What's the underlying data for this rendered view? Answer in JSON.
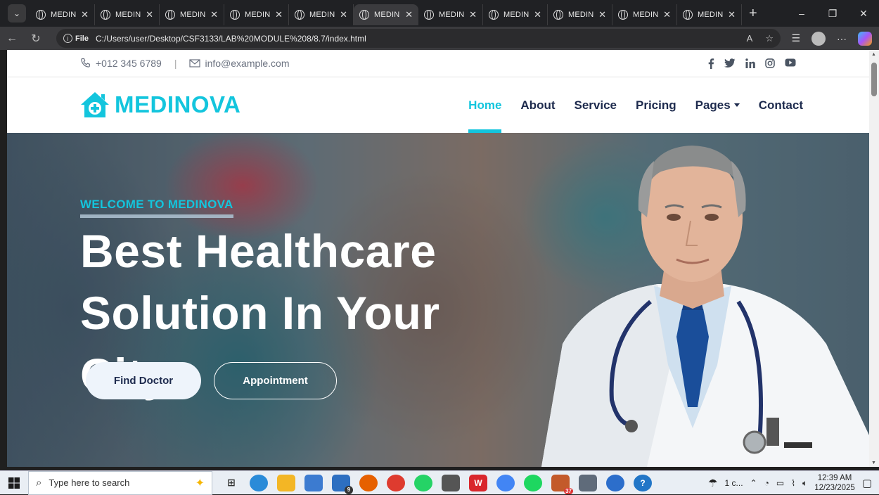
{
  "browser": {
    "tab_count_label": "MEDINOVA",
    "tabs": [
      {
        "title": "MEDIN",
        "active": false
      },
      {
        "title": "MEDIN",
        "active": false
      },
      {
        "title": "MEDIN",
        "active": false
      },
      {
        "title": "MEDIN",
        "active": false
      },
      {
        "title": "MEDIN",
        "active": false
      },
      {
        "title": "MEDIN",
        "active": true
      },
      {
        "title": "MEDIN",
        "active": false
      },
      {
        "title": "MEDIN",
        "active": false
      },
      {
        "title": "MEDIN",
        "active": false
      },
      {
        "title": "MEDIN",
        "active": false
      },
      {
        "title": "MEDIN",
        "active": false
      }
    ],
    "first_tab_title": "MEDIN",
    "address": {
      "scheme_label": "File",
      "url": "C:/Users/user/Desktop/CSF3133/LAB%20MODULE%208/8.7/index.html"
    },
    "controls": {
      "new_tab": "+",
      "minimize": "–",
      "restore": "❐",
      "close": "✕",
      "more": "···"
    }
  },
  "site": {
    "topbar": {
      "phone": "+012 345 6789",
      "separator": "|",
      "email": "info@example.com",
      "socials": [
        "f",
        "t",
        "in",
        "ig",
        "yt"
      ]
    },
    "brand": {
      "name": "MEDINOVA",
      "color": "#13c5dd"
    },
    "nav": [
      {
        "label": "Home",
        "active": true
      },
      {
        "label": "About",
        "active": false
      },
      {
        "label": "Service",
        "active": false
      },
      {
        "label": "Pricing",
        "active": false
      },
      {
        "label": "Pages",
        "active": false,
        "dropdown": true
      },
      {
        "label": "Contact",
        "active": false
      }
    ],
    "hero": {
      "eyebrow": "WELCOME TO MEDINOVA",
      "headline_line1": "Best Healthcare",
      "headline_line2": "Solution In Your City",
      "primary_button": "Find Doctor",
      "secondary_button": "Appointment"
    }
  },
  "taskbar": {
    "search_placeholder": "Type here to search",
    "weather": "1 c...",
    "time": "12:39 AM",
    "date": "12/23/2025",
    "mail_badge": "9",
    "telegram_badge": "37"
  }
}
